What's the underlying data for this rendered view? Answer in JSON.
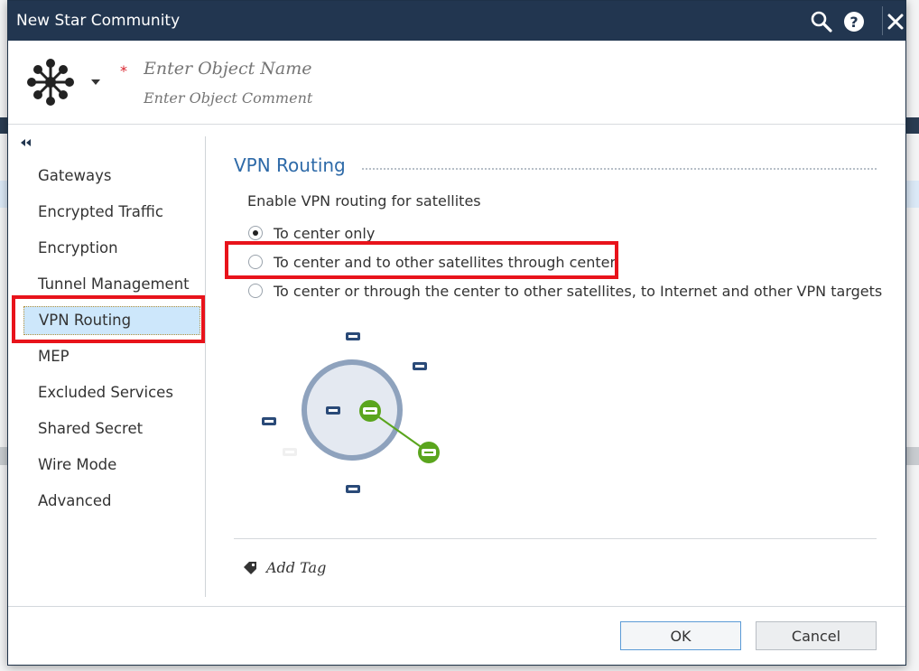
{
  "window": {
    "title": "New Star Community"
  },
  "header": {
    "name_placeholder": "Enter Object Name",
    "comment_placeholder": "Enter Object Comment",
    "required_mark": "*"
  },
  "sidebar": {
    "items": [
      {
        "label": "Gateways"
      },
      {
        "label": "Encrypted Traffic"
      },
      {
        "label": "Encryption"
      },
      {
        "label": "Tunnel Management"
      },
      {
        "label": "VPN Routing"
      },
      {
        "label": "MEP"
      },
      {
        "label": "Excluded Services"
      },
      {
        "label": "Shared Secret"
      },
      {
        "label": "Wire Mode"
      },
      {
        "label": "Advanced"
      }
    ],
    "active": "VPN Routing"
  },
  "content": {
    "section_title": "VPN Routing",
    "intro": "Enable VPN routing for satellites",
    "options": [
      {
        "label": "To center only",
        "checked": true
      },
      {
        "label": "To center and to other satellites through center",
        "checked": false
      },
      {
        "label": "To center or through the center to other satellites, to Internet and other VPN targets",
        "checked": false
      }
    ],
    "add_tag": "Add Tag"
  },
  "footer": {
    "ok": "OK",
    "cancel": "Cancel"
  },
  "colors": {
    "titlebar": "#223650",
    "accent_blue": "#2e6aa8",
    "highlight_red": "#e8131b",
    "active_nav": "#cde7fb",
    "diagram_green": "#5aa51d",
    "diagram_navy": "#2a4a78"
  },
  "icons": [
    "search-icon",
    "help-icon",
    "close-icon",
    "star-community-icon",
    "chevron-down-icon",
    "collapse-icon",
    "tag-icon",
    "gateway-icon"
  ]
}
